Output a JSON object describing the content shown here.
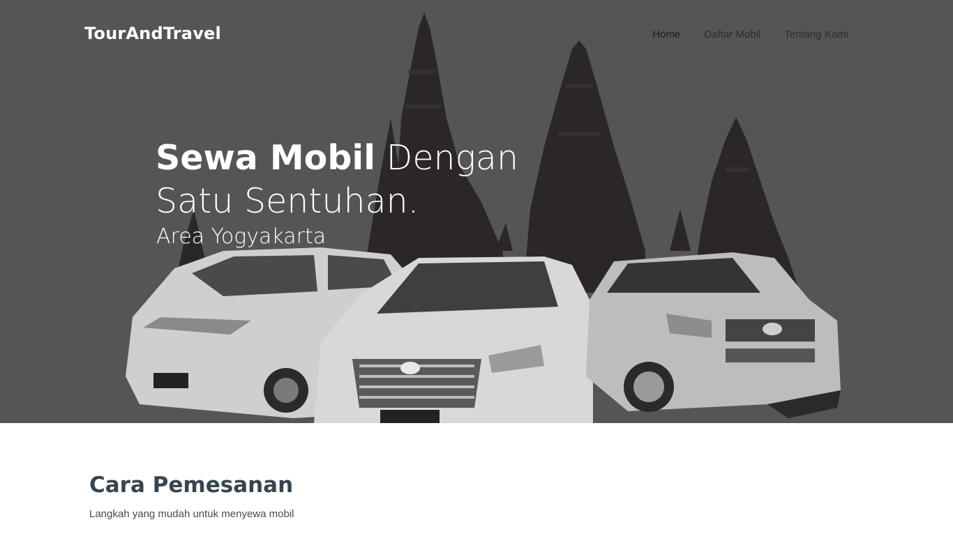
{
  "header": {
    "brand": "TourAndTravel",
    "nav": [
      {
        "label": "Home"
      },
      {
        "label": "Daftar Mobil"
      },
      {
        "label": "Tentang Kami"
      }
    ]
  },
  "hero": {
    "title_strong": "Sewa Mobil",
    "title_rest": " Dengan",
    "title_line2": "Satu Sentuhan.",
    "subtitle": "Area Yogyakarta",
    "background_color": "#555556"
  },
  "section": {
    "title": "Cara Pemesanan",
    "subtitle": "Langkah yang mudah untuk menyewa mobil"
  }
}
